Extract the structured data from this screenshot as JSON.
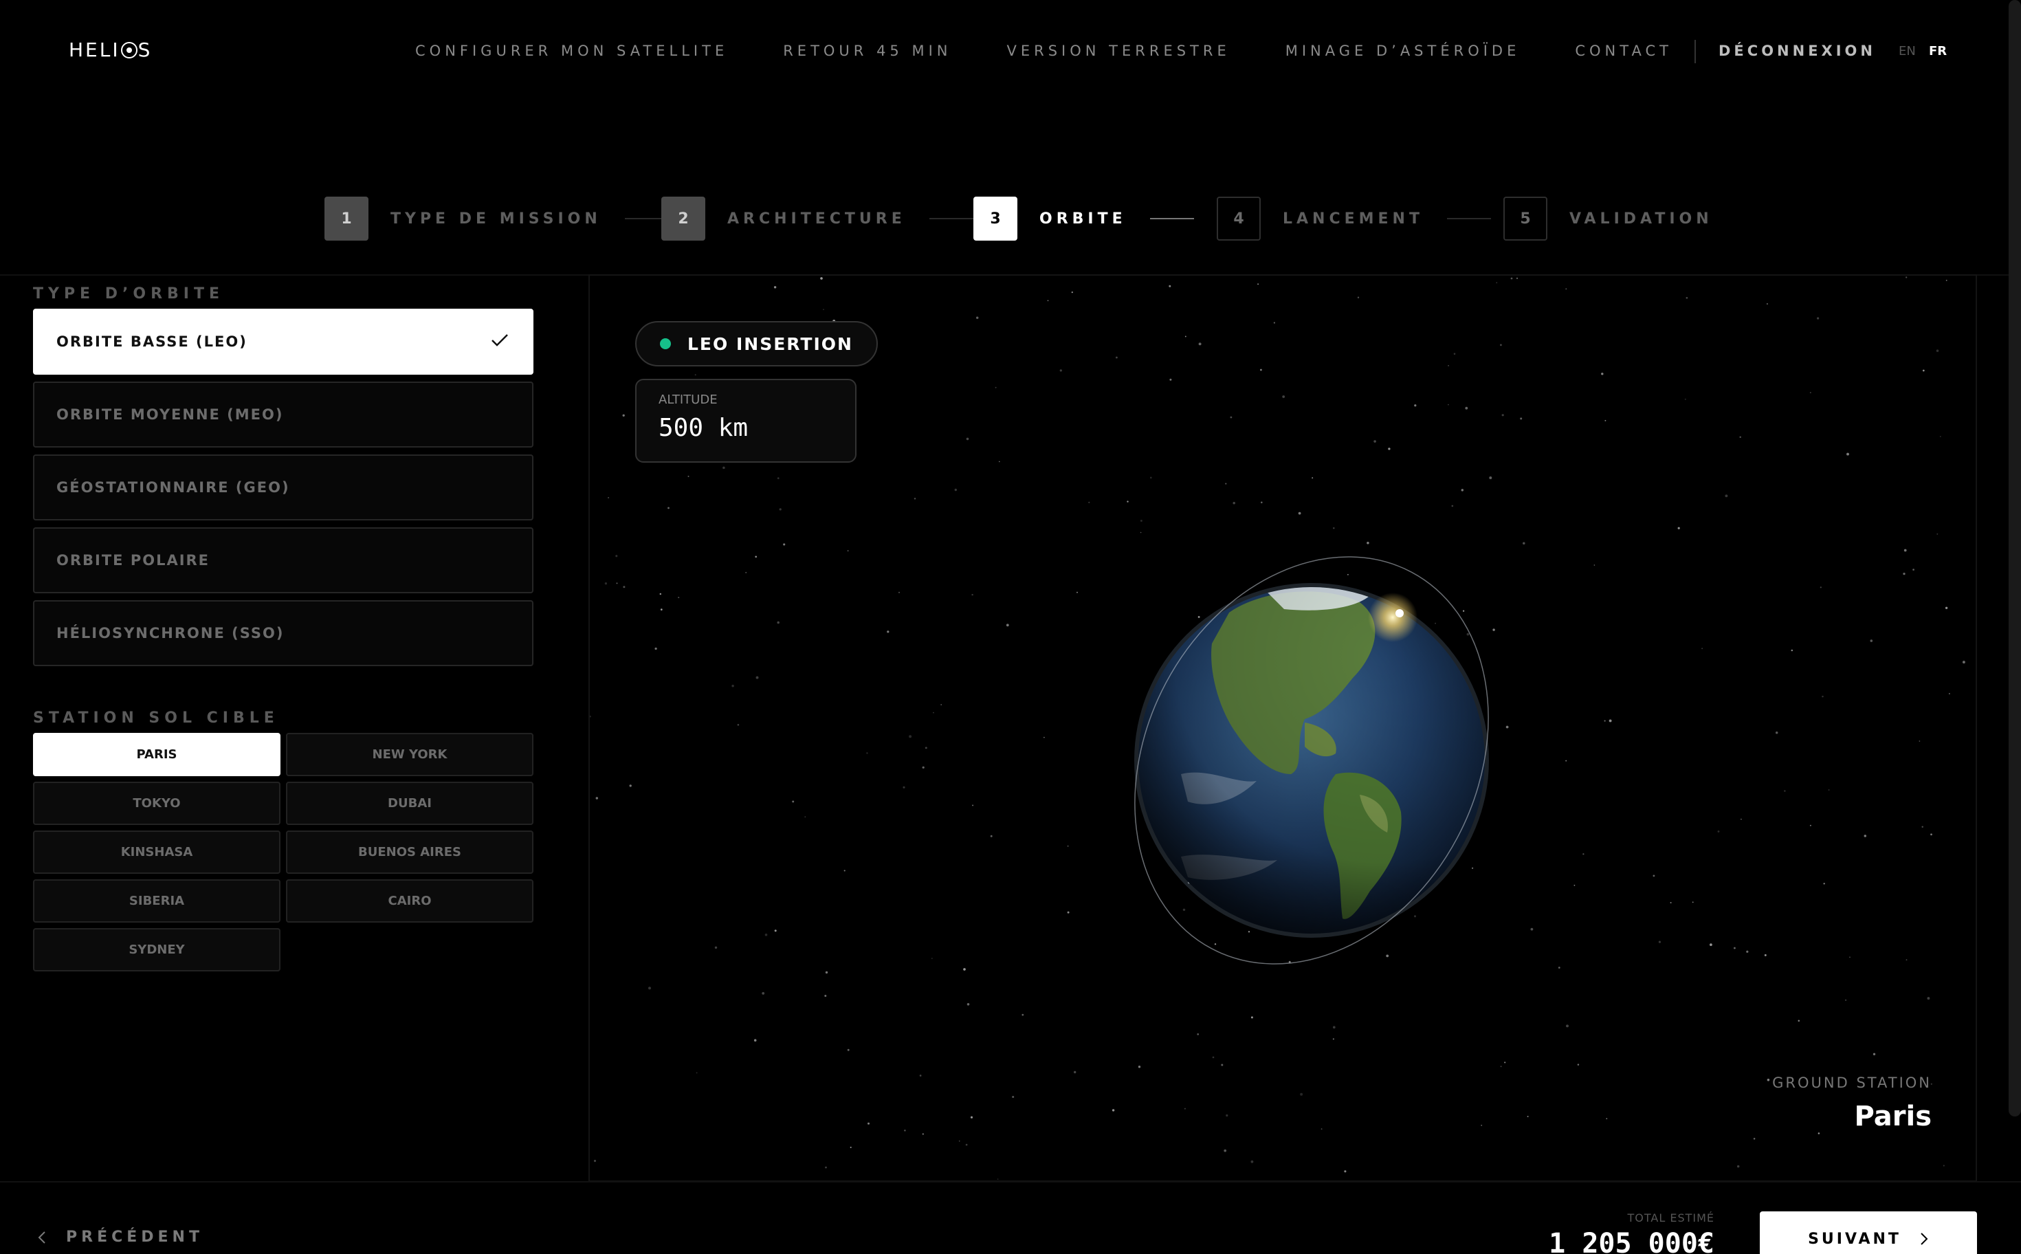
{
  "header": {
    "logo_prefix": "HEL",
    "logo_suffix": "S",
    "nav": [
      {
        "label": "CONFIGURER MON SATELLITE"
      },
      {
        "label": "RETOUR 45 MIN"
      },
      {
        "label": "VERSION TERRESTRE"
      },
      {
        "label": "MINAGE D’ASTÉROÏDE"
      },
      {
        "label": "CONTACT"
      }
    ],
    "logout": "DÉCONNEXION",
    "lang_en": "EN",
    "lang_fr": "FR"
  },
  "stepper": [
    {
      "num": "1",
      "label": "TYPE DE MISSION",
      "state": "done"
    },
    {
      "num": "2",
      "label": "ARCHITECTURE",
      "state": "done"
    },
    {
      "num": "3",
      "label": "ORBITE",
      "state": "active"
    },
    {
      "num": "4",
      "label": "LANCEMENT",
      "state": "pending"
    },
    {
      "num": "5",
      "label": "VALIDATION",
      "state": "pending"
    }
  ],
  "orbit": {
    "title": "TYPE D’ORBITE",
    "options": [
      {
        "label": "ORBITE BASSE (LEO)",
        "selected": true
      },
      {
        "label": "ORBITE MOYENNE (MEO)",
        "selected": false
      },
      {
        "label": "GÉOSTATIONNAIRE (GEO)",
        "selected": false
      },
      {
        "label": "ORBITE POLAIRE",
        "selected": false
      },
      {
        "label": "HÉLIOSYNCHRONE (SSO)",
        "selected": false
      }
    ]
  },
  "station": {
    "title": "STATION SOL CIBLE",
    "options": [
      {
        "label": "PARIS",
        "selected": true
      },
      {
        "label": "NEW YORK",
        "selected": false
      },
      {
        "label": "TOKYO",
        "selected": false
      },
      {
        "label": "DUBAI",
        "selected": false
      },
      {
        "label": "KINSHASA",
        "selected": false
      },
      {
        "label": "BUENOS AIRES",
        "selected": false
      },
      {
        "label": "SIBERIA",
        "selected": false
      },
      {
        "label": "CAIRO",
        "selected": false
      },
      {
        "label": "SYDNEY",
        "selected": false
      }
    ]
  },
  "viewport": {
    "badge": "LEO INSERTION",
    "badge_color": "#16c08a",
    "altitude_label": "ALTITUDE",
    "altitude_value": "500 km",
    "ground_station_label": "GROUND STATION",
    "ground_station_value": "Paris"
  },
  "footer": {
    "prev_label": "PRÉCÉDENT",
    "total_label": "TOTAL ESTIMÉ",
    "total_value": "1 205 000€",
    "next_label": "SUIVANT"
  }
}
